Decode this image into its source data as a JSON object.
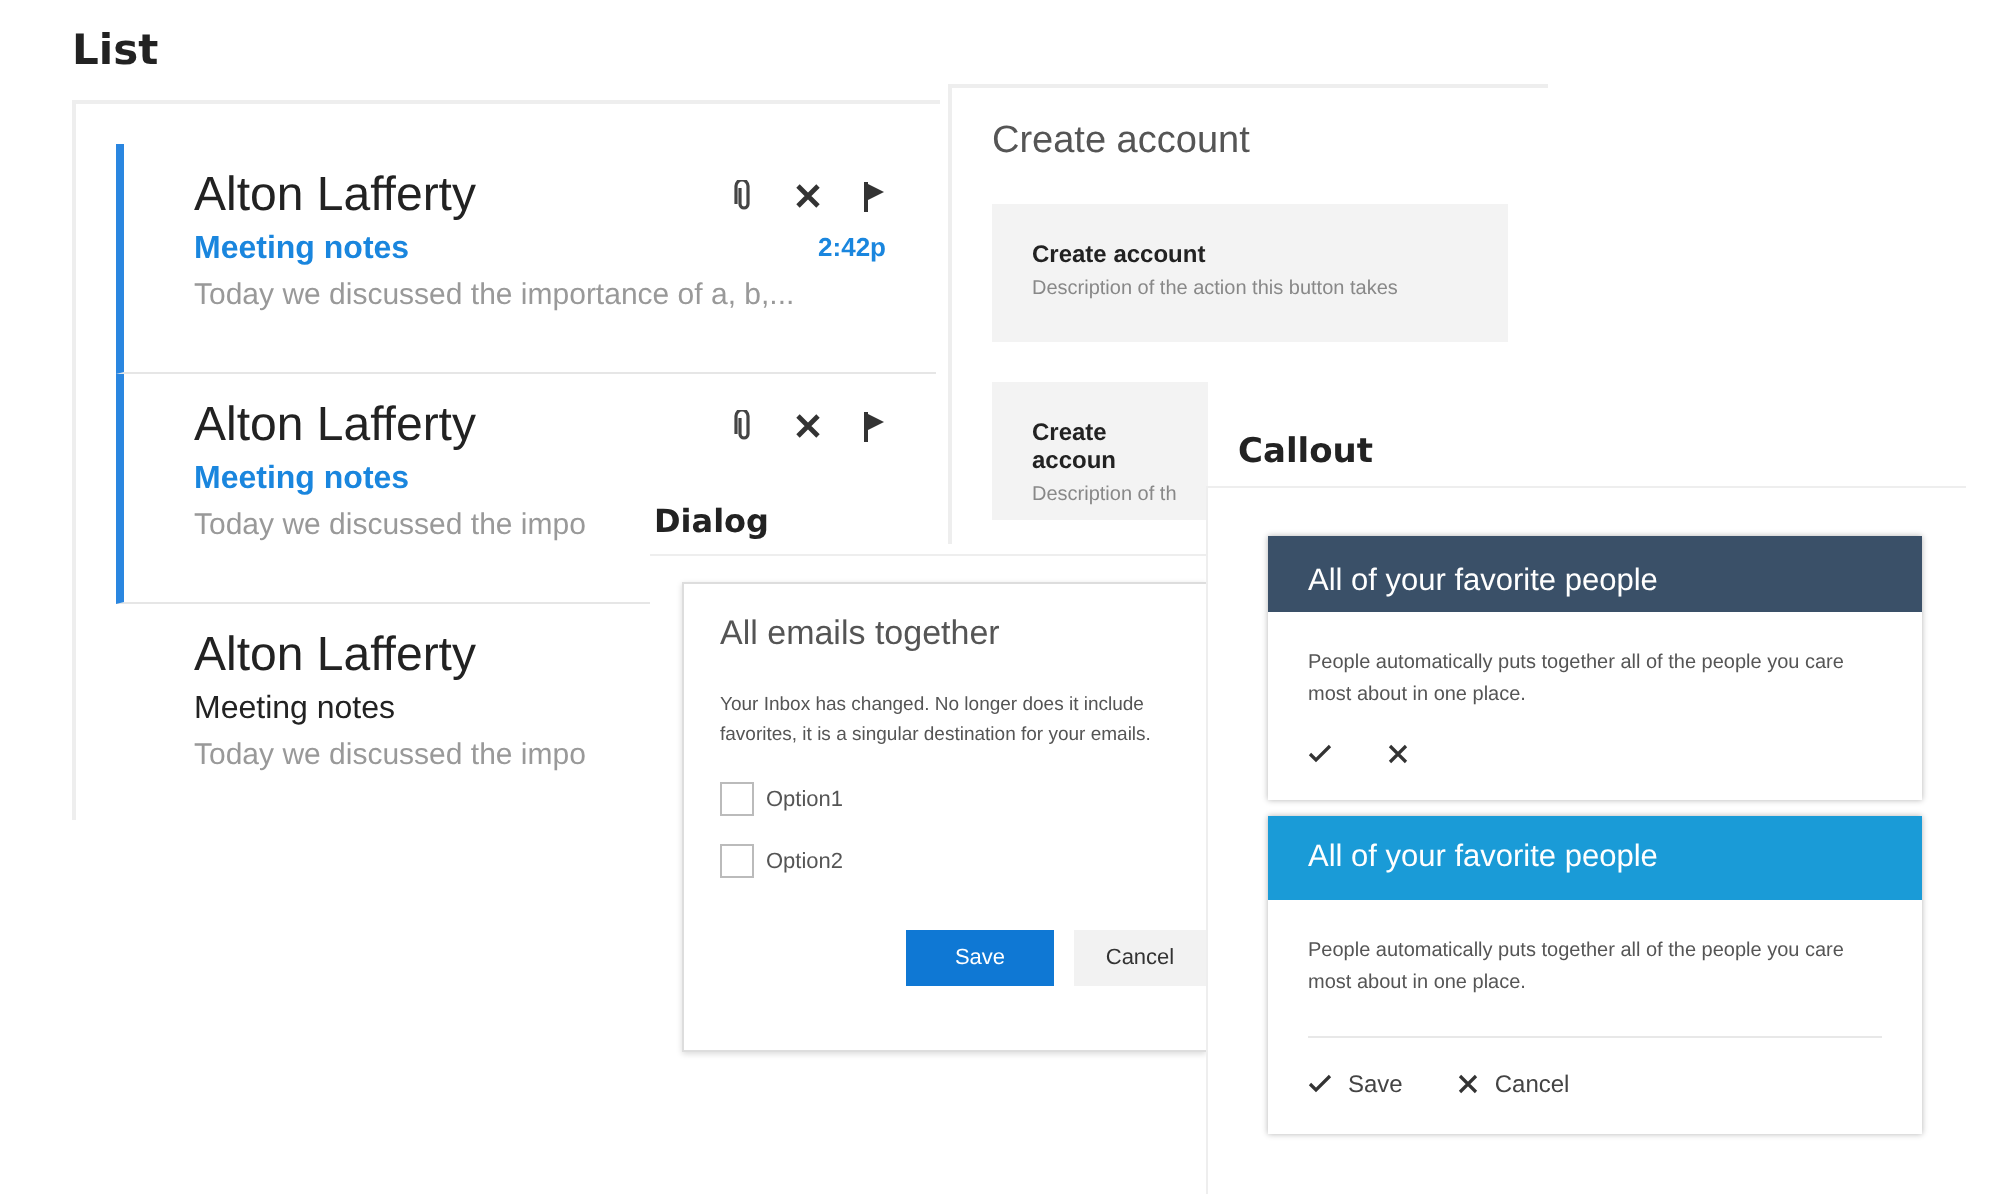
{
  "list": {
    "heading": "List",
    "items": [
      {
        "sender": "Alton Lafferty",
        "subject": "Meeting notes",
        "time": "2:42p",
        "preview": "Today we discussed the importance of a, b,...",
        "unread": true,
        "show_actions": true
      },
      {
        "sender": "Alton Lafferty",
        "subject": "Meeting notes",
        "preview": "Today we discussed the impo",
        "unread": true,
        "show_actions": true
      },
      {
        "sender": "Alton Lafferty",
        "subject": "Meeting notes",
        "preview": "Today we discussed the impo",
        "unread": false,
        "show_actions": false
      }
    ]
  },
  "create_account": {
    "title": "Create account",
    "buttons": [
      {
        "label": "Create account",
        "description": "Description of the action this button takes"
      },
      {
        "label": "Create accoun",
        "description": "Description of th"
      }
    ]
  },
  "dialog": {
    "heading": "Dialog",
    "title": "All emails together",
    "body": [
      "Your Inbox has changed. No longer does it include",
      "favorites, it is a singular destination for your emails."
    ],
    "options": [
      {
        "label": "Option1",
        "checked": false
      },
      {
        "label": "Option2",
        "checked": false
      }
    ],
    "buttons": [
      {
        "label": "Save",
        "kind": "primary"
      },
      {
        "label": "Cancel",
        "kind": "secondary"
      }
    ]
  },
  "callout": {
    "heading": "Callout",
    "cards": [
      {
        "title": "All of your favorite people",
        "color": "#3a5068",
        "text": "People automatically puts together all of the people you care most about in one place.",
        "divider": false,
        "actions": [
          {
            "kind": "confirm"
          },
          {
            "kind": "dismiss"
          }
        ]
      },
      {
        "title": "All of your favorite people",
        "color": "#1a9bd7",
        "text": "People automatically puts together all of the people you care most about in one place.",
        "divider": true,
        "actions": [
          {
            "kind": "confirm",
            "label": "Save"
          },
          {
            "kind": "dismiss",
            "label": "Cancel"
          }
        ]
      }
    ]
  }
}
